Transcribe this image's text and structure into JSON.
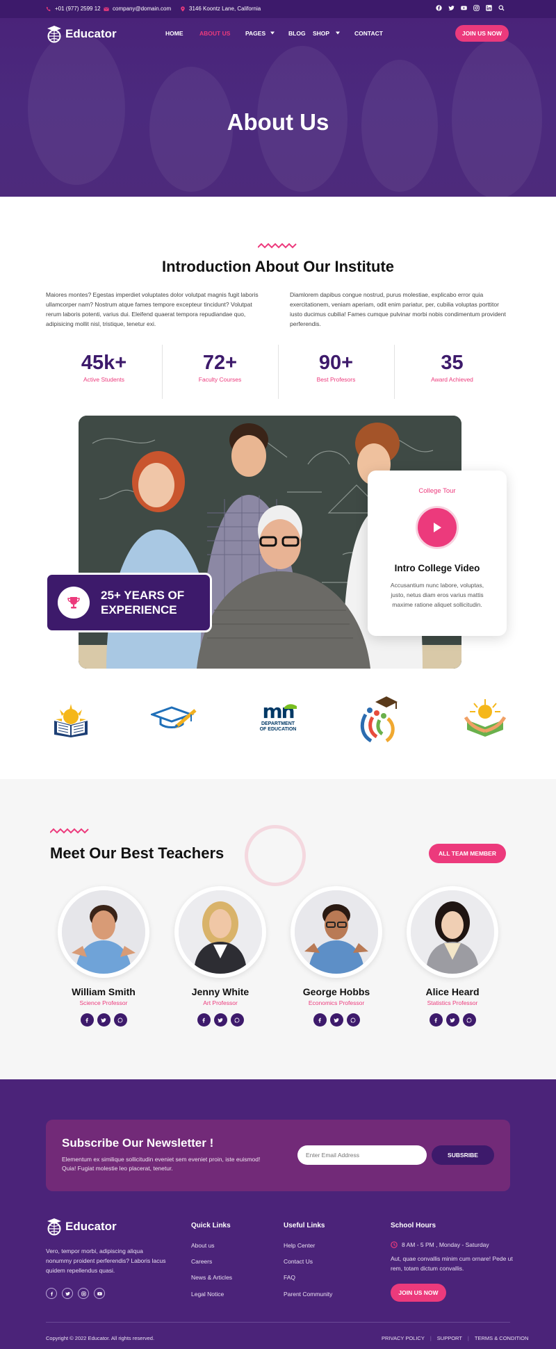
{
  "topbar": {
    "phone": "+01 (977) 2599 12",
    "email": "company@domain.com",
    "address": "3146 Koontz Lane, California",
    "social_icons": [
      "facebook-icon",
      "twitter-icon",
      "youtube-icon",
      "instagram-icon",
      "linkedin-icon",
      "search-icon"
    ]
  },
  "brand": {
    "name": "Educator",
    "accent": "#ec3a7c",
    "primary": "#3d1a6b"
  },
  "nav": {
    "items": [
      "HOME",
      "ABOUT US",
      "PAGES",
      "BLOG",
      "SHOP",
      "CONTACT"
    ],
    "active": "ABOUT US",
    "cta": "JOIN US NOW"
  },
  "hero": {
    "title": "About Us"
  },
  "intro": {
    "title": "Introduction About Our Institute",
    "left_text": "Maiores montes? Egestas imperdiet voluptates dolor volutpat magnis fugit laboris ullamcorper nam? Nostrum atque fames tempore excepteur tincidunt? Volutpat rerum laboris potenti, varius dui. Eleifend quaerat tempora repudiandae quo, adipisicing mollit nisl, tristique, tenetur exi.",
    "right_text": "Diamlorem dapibus congue nostrud, purus molestiae, explicabo error quia exercitationem, veniam aperiam, odit enim pariatur, per, cubilia voluptas porttitor iusto ducimus cubilia! Fames cumque pulvinar morbi nobis condimentum provident perferendis."
  },
  "stats": [
    {
      "num": "45k+",
      "label": "Active Students"
    },
    {
      "num": "72+",
      "label": "Faculty Courses"
    },
    {
      "num": "90+",
      "label": "Best Profesors"
    },
    {
      "num": "35",
      "label": "Award Achieved"
    }
  ],
  "experience": {
    "line1": "25+ YEARS OF",
    "line2": "EXPERIENCE"
  },
  "video_card": {
    "eyebrow": "College Tour",
    "title": "Intro College Video",
    "text": "Accusantium nunc labore, voluptas, justo, netus diam eros varius mattis maxime ratione aliquet sollicitudin."
  },
  "partner_logos": {
    "mn_letters": "mn",
    "mn_line1": "DEPARTMENT",
    "mn_line2": "OF EDUCATION"
  },
  "teachers": {
    "title": "Meet Our Best Teachers",
    "cta": "ALL TEAM MEMBER",
    "list": [
      {
        "name": "William Smith",
        "role": "Science Professor"
      },
      {
        "name": "Jenny White",
        "role": "Art Professor"
      },
      {
        "name": "George Hobbs",
        "role": "Economics Professor"
      },
      {
        "name": "Alice Heard",
        "role": "Statistics Professor"
      }
    ]
  },
  "newsletter": {
    "title": "Subscribe Our Newsletter !",
    "text": "Elementum ex similique sollicitudin eveniet sem eveniet proin, iste euismod! Quia! Fugiat molestie leo placerat, tenetur.",
    "placeholder": "Enter Email Address",
    "button": "SUBSRIBE"
  },
  "footer": {
    "about": "Vero, tempor morbi, adipiscing aliqua nonummy proident perferendis? Laboris lacus quidem repellendus quasi.",
    "quick_title": "Quick Links",
    "quick": [
      "About us",
      "Careers",
      "News & Articles",
      "Legal Notice"
    ],
    "useful_title": "Useful Links",
    "useful": [
      "Help Center",
      "Contact Us",
      "FAQ",
      "Parent Community"
    ],
    "hours_title": "School Hours",
    "hours": "8 AM - 5 PM , Monday - Saturday",
    "hours_text": "Aut, quae convallis minim cum ornare! Pede ut rem, totam dictum convallis.",
    "cta": "JOIN US NOW",
    "copyright": "Copyright © 2022 Educator. All rights reserved.",
    "legal": [
      "PRIVACY POLICY",
      "SUPPORT",
      "TERMS & CONDITION"
    ]
  }
}
